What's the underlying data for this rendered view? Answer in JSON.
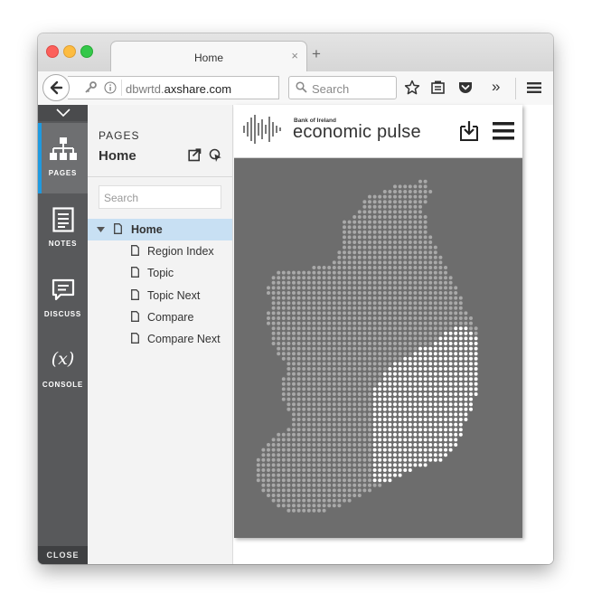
{
  "browser": {
    "tab_title": "Home",
    "tab_close": "×",
    "new_tab": "+",
    "url_prefix": "dbwrtd.",
    "url_host": "axshare.com",
    "search_placeholder": "Search",
    "overflow_label": "»"
  },
  "iconbar": {
    "items": [
      {
        "label": "PAGES",
        "icon": "sitemap-icon",
        "active": true
      },
      {
        "label": "NOTES",
        "icon": "notes-icon",
        "active": false
      },
      {
        "label": "DISCUSS",
        "icon": "discuss-icon",
        "active": false
      },
      {
        "label": "CONSOLE",
        "icon": "variable-icon",
        "glyph": "(x)",
        "active": false
      }
    ],
    "close_label": "CLOSE"
  },
  "pages_panel": {
    "header": "PAGES",
    "title": "Home",
    "search_placeholder": "Search",
    "tree": [
      {
        "label": "Home",
        "level": 0,
        "selected": true
      },
      {
        "label": "Region Index",
        "level": 1
      },
      {
        "label": "Topic",
        "level": 1
      },
      {
        "label": "Topic Next",
        "level": 1
      },
      {
        "label": "Compare",
        "level": 1
      },
      {
        "label": "Compare Next",
        "level": 1
      }
    ]
  },
  "preview": {
    "brand_small": "Bank of Ireland",
    "brand_title": "economic pulse",
    "colors": {
      "background": "#6d6d6d",
      "dot_grey": "#a9a9a9",
      "dot_highlight": "#ffffff"
    }
  }
}
